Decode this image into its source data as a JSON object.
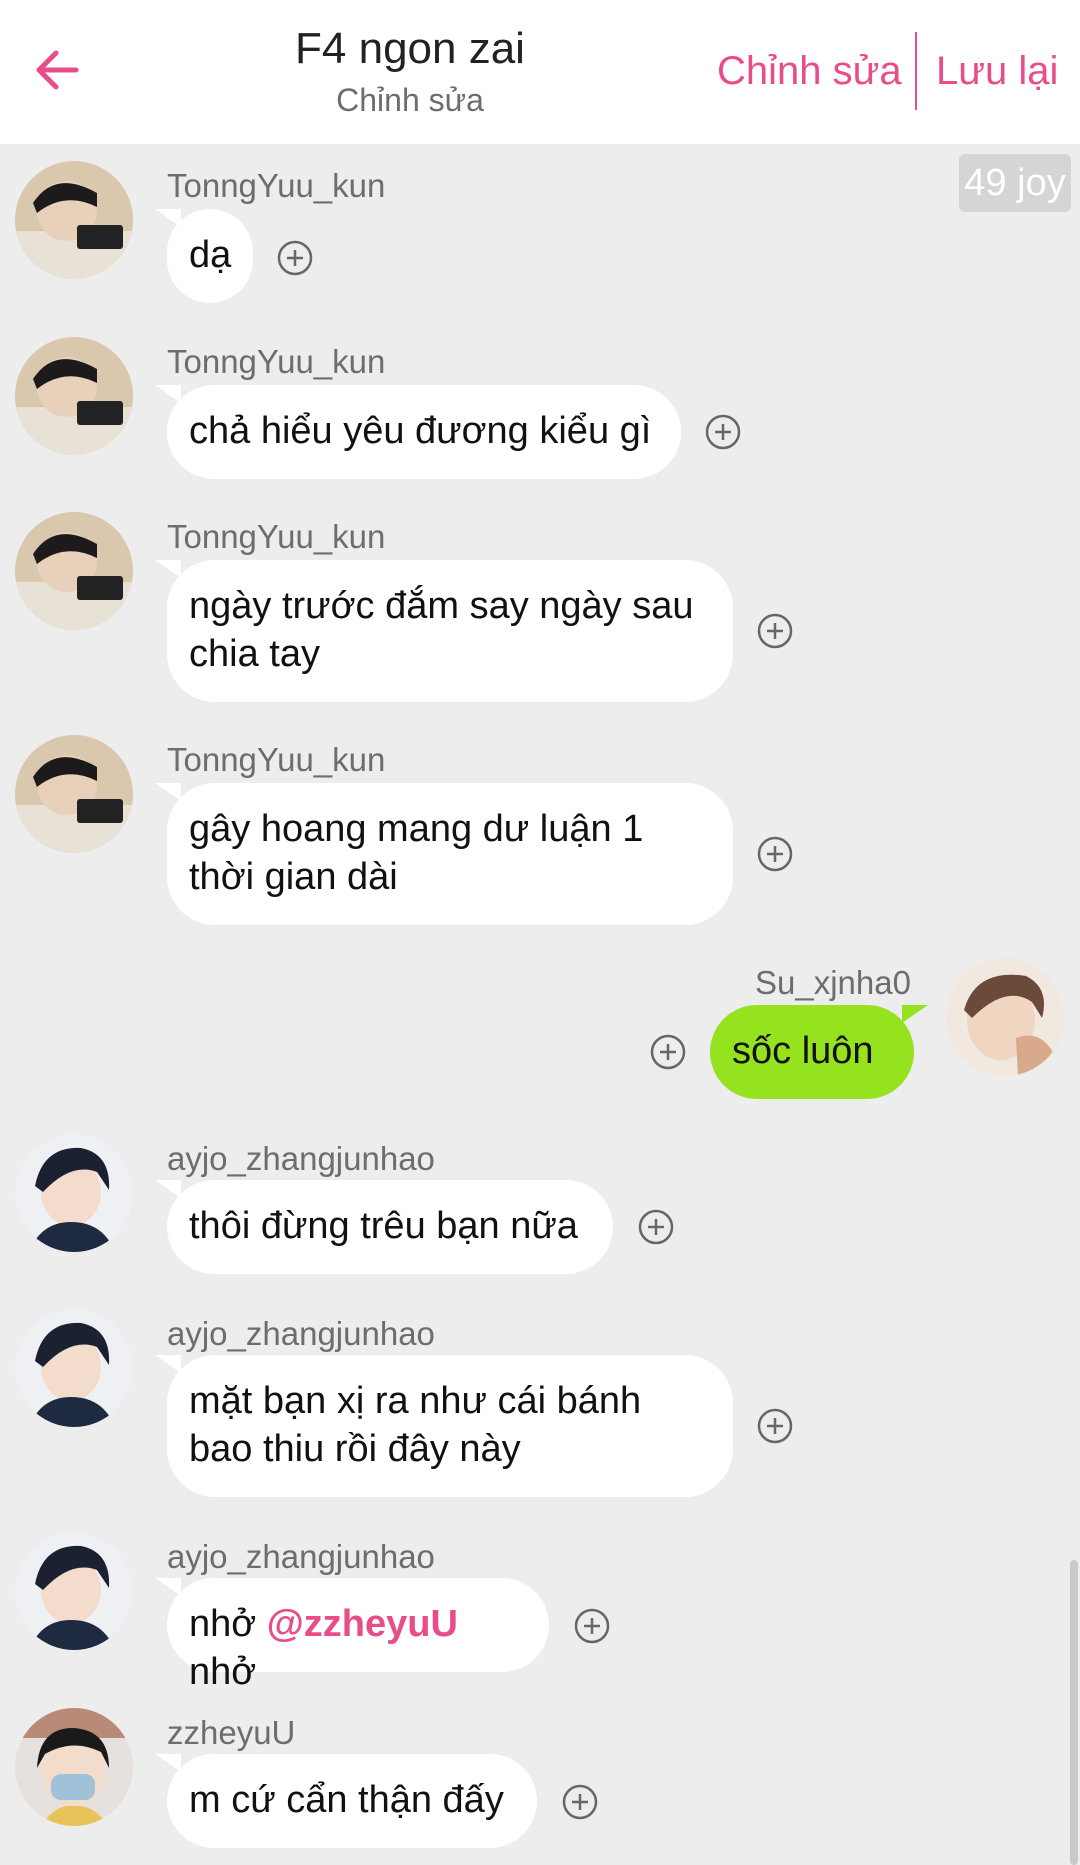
{
  "header": {
    "title": "F4 ngon zai",
    "subtitle": "Chỉnh sửa",
    "edit_label": "Chỉnh sửa",
    "save_label": "Lưu lại",
    "accent_color": "#e84d8a"
  },
  "joy_badge": "49 joy",
  "messages": [
    {
      "user": "TonngYuu_kun",
      "lines": [
        "dạ"
      ],
      "side": "left"
    },
    {
      "user": "TonngYuu_kun",
      "lines": [
        "chả hiểu yêu đương kiểu gì"
      ],
      "side": "left"
    },
    {
      "user": "TonngYuu_kun",
      "lines": [
        "ngày trước đắm say ngày sau",
        "chia tay"
      ],
      "side": "left"
    },
    {
      "user": "TonngYuu_kun",
      "lines": [
        "gây hoang mang dư luận 1",
        "thời gian dài"
      ],
      "side": "left"
    },
    {
      "user": "Su_xjnha0",
      "lines": [
        "sốc luôn"
      ],
      "side": "right",
      "bubble_color": "#95e21f"
    },
    {
      "user": "ayjo_zhangjunhao",
      "lines": [
        "thôi đừng trêu bạn nữa"
      ],
      "side": "left"
    },
    {
      "user": "ayjo_zhangjunhao",
      "lines": [
        "mặt bạn xị ra như cái bánh",
        "bao thiu rồi đây này"
      ],
      "side": "left"
    },
    {
      "user": "ayjo_zhangjunhao",
      "text_before": "nhở ",
      "mention": "@zzheyuU",
      "text_after": " nhở",
      "side": "left"
    },
    {
      "user": "zzheyuU",
      "lines": [
        "m cứ cẩn thận đấy"
      ],
      "side": "left"
    }
  ]
}
